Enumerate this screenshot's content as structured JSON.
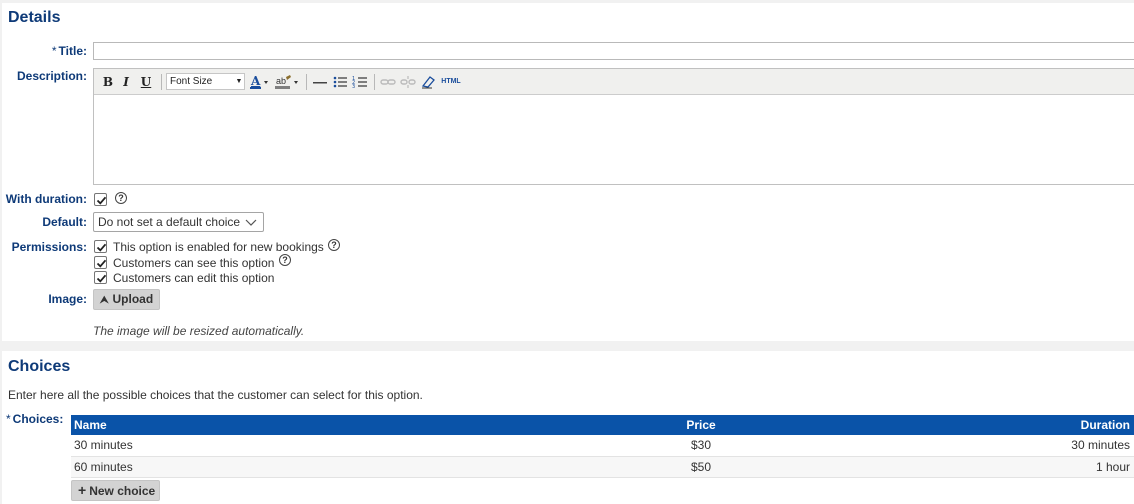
{
  "details": {
    "heading": "Details",
    "title_label": "Title:",
    "title_value": "",
    "required_mark": "*",
    "description_label": "Description:",
    "toolbar": {
      "bold": "B",
      "italic": "I",
      "underline": "U",
      "font_size": "Font Size",
      "html": "HTML"
    },
    "with_duration_label": "With duration:",
    "with_duration_checked": true,
    "default_label": "Default:",
    "default_value": "Do not set a default choice",
    "permissions_label": "Permissions:",
    "permissions": [
      {
        "label": "This option is enabled for new bookings",
        "checked": true,
        "help": true
      },
      {
        "label": "Customers can see this option",
        "checked": true,
        "help": true
      },
      {
        "label": "Customers can edit this option",
        "checked": true,
        "help": false
      }
    ],
    "image_label": "Image:",
    "upload_label": "Upload",
    "image_note": "The image will be resized automatically."
  },
  "choices": {
    "heading": "Choices",
    "intro": "Enter here all the possible choices that the customer can select for this option.",
    "choices_label": "Choices:",
    "columns": [
      "Name",
      "Price",
      "Duration"
    ],
    "rows": [
      {
        "name": "30 minutes",
        "price": "$30",
        "duration": "30 minutes"
      },
      {
        "name": "60 minutes",
        "price": "$50",
        "duration": "1 hour"
      }
    ],
    "new_choice_label": "New choice"
  },
  "colors": {
    "accent": "#0e3a78",
    "table_header": "#0a53a8"
  },
  "icons": [
    "help-icon",
    "checkmark-icon",
    "upload-icon",
    "plus-icon",
    "chevron-down-icon"
  ]
}
